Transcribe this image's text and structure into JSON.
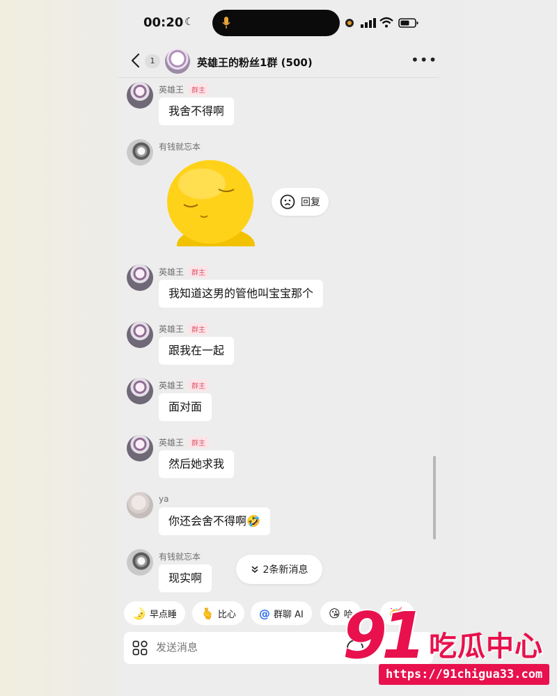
{
  "status_bar": {
    "time": "00:20",
    "icons": [
      "moon-icon",
      "microphone-icon",
      "recording-dot-icon",
      "signal-icon",
      "wifi-icon",
      "battery-icon"
    ]
  },
  "header": {
    "unread_count": "1",
    "title": "英雄王的粉丝1群 (500)",
    "more_label": "•••"
  },
  "messages": [
    {
      "sender": "英雄王",
      "badge": "群主",
      "text": "我舍不得啊"
    },
    {
      "sender": "有钱就忘本",
      "type": "sticker",
      "reply_label": "回复"
    },
    {
      "sender": "英雄王",
      "badge": "群主",
      "text": "我知道这男的管他叫宝宝那个"
    },
    {
      "sender": "英雄王",
      "badge": "群主",
      "text": "跟我在一起"
    },
    {
      "sender": "英雄王",
      "badge": "群主",
      "text": "面对面"
    },
    {
      "sender": "英雄王",
      "badge": "群主",
      "text": "然后她求我"
    },
    {
      "sender": "ya",
      "text": "你还会舍不得啊🤣"
    },
    {
      "sender": "有钱就忘本",
      "text": "现实啊"
    }
  ],
  "new_messages_label": "2条新消息",
  "quick_replies": [
    {
      "icon": "🌛",
      "label": "早点睡"
    },
    {
      "icon": "🫰",
      "label": "比心"
    },
    {
      "icon": "@",
      "label": "群聊 AI"
    },
    {
      "icon": "😘",
      "label": "哈"
    },
    {
      "icon": "🥳",
      "label": ""
    }
  ],
  "input": {
    "placeholder": "发送消息"
  },
  "watermark": {
    "number": "91",
    "text": "吃瓜中心",
    "url": "https://91chigua33.com"
  },
  "colors": {
    "badge_text": "#e0566c",
    "watermark": "#e8114d",
    "background": "#ededed"
  }
}
